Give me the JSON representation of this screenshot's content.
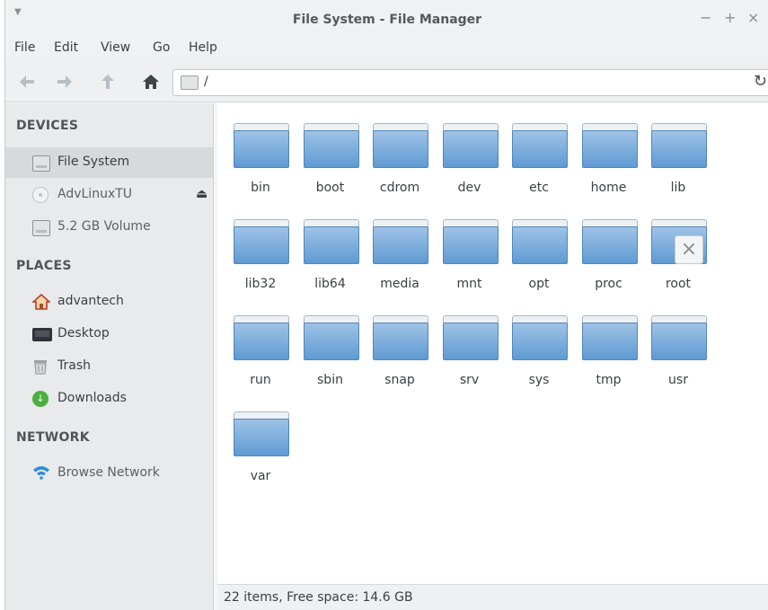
{
  "window": {
    "title": "File System - File Manager"
  },
  "menu": [
    "File",
    "Edit",
    "View",
    "Go",
    "Help"
  ],
  "address": {
    "path": "/"
  },
  "sidebar": {
    "devices_header": "DEVICES",
    "devices": [
      {
        "label": "File System",
        "icon": "hard-drive-icon",
        "selected": true
      },
      {
        "label": "AdvLinuxTU",
        "icon": "disc-icon"
      },
      {
        "label": "5.2 GB Volume",
        "icon": "hard-drive-icon"
      }
    ],
    "places_header": "PLACES",
    "places": [
      {
        "label": "advantech",
        "icon": "home-icon"
      },
      {
        "label": "Desktop",
        "icon": "desktop-icon"
      },
      {
        "label": "Trash",
        "icon": "trash-icon"
      },
      {
        "label": "Downloads",
        "icon": "downloads-icon"
      }
    ],
    "network_header": "NETWORK",
    "network": [
      {
        "label": "Browse Network",
        "icon": "wifi-icon"
      }
    ]
  },
  "folders": [
    "bin",
    "boot",
    "cdrom",
    "dev",
    "etc",
    "home",
    "lib",
    "lib32",
    "lib64",
    "media",
    "mnt",
    "opt",
    "proc",
    "root",
    "run",
    "sbin",
    "snap",
    "srv",
    "sys",
    "tmp",
    "usr",
    "var"
  ],
  "status": {
    "text": "22 items, Free space: 14.6 GB"
  },
  "colors": {
    "folder": "#6fa6d8",
    "selection": "#d7dadd",
    "sidebar": "#e8eaec"
  }
}
